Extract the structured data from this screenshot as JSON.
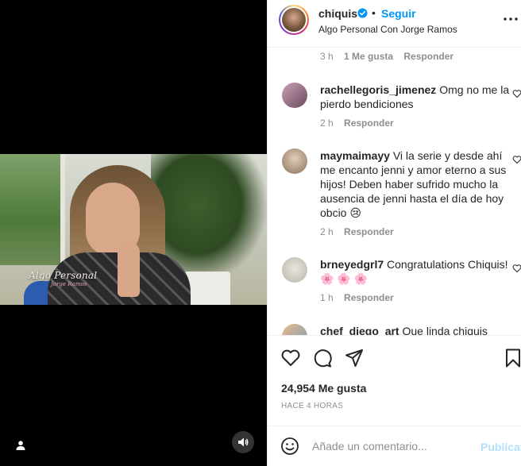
{
  "video": {
    "overlay_title": "Algo Personal",
    "overlay_subtitle": "Jorge Ramos",
    "user_tag_icon": "user-icon",
    "audio_icon": "speaker-icon"
  },
  "header": {
    "username": "chiquis",
    "separator": "•",
    "follow_label": "Seguir",
    "subtitle": "Algo Personal Con Jorge Ramos",
    "more_icon": "more-options-icon"
  },
  "top_meta": {
    "time": "3 h",
    "likes": "1 Me gusta",
    "reply": "Responder"
  },
  "comments": [
    {
      "user": "rachellegoris_jimenez",
      "text": "Omg no me la pierdo bendiciones",
      "time": "2 h",
      "reply": "Responder"
    },
    {
      "user": "maymaimayy",
      "text": "Vi la serie y desde ahí me encanto jenni y amor eterno a sus hijos! Deben haber sufrido mucho la ausencia de jenni hasta el día de hoy obcio 😢",
      "time": "2 h",
      "reply": "Responder"
    },
    {
      "user": "brneyedgrl7",
      "text": "Congratulations Chiquis! 🌸 🌸 🌸",
      "time": "1 h",
      "reply": "Responder"
    },
    {
      "user": "chef_diego_art",
      "text": "Que linda chiquis"
    }
  ],
  "actions": {
    "like_icon": "heart-icon",
    "comment_icon": "comment-icon",
    "share_icon": "share-icon",
    "save_icon": "bookmark-icon",
    "likes_count": "24,954 Me gusta",
    "date": "HACE 4 HORAS"
  },
  "composer": {
    "emoji_icon": "emoji-icon",
    "placeholder": "Añade un comentario...",
    "publish_label": "Publicar"
  },
  "colors": {
    "accent": "#0095f6",
    "publish_disabled": "#b2dffc",
    "muted": "#8e8e8e",
    "text": "#262626"
  }
}
